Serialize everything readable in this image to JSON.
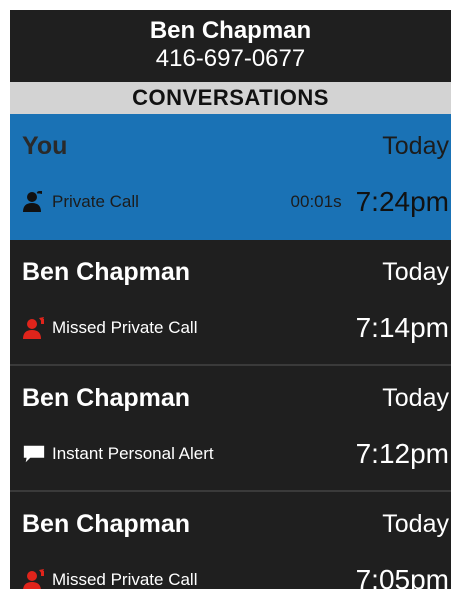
{
  "header": {
    "contact_name": "Ben Chapman",
    "phone_number": "416-697-0677"
  },
  "section_title": "CONVERSATIONS",
  "conversations": [
    {
      "sender": "You",
      "day": "Today",
      "icon": "outgoing-private-call-icon",
      "label": "Private Call",
      "duration": "00:01s",
      "time": "7:24pm",
      "selected": true
    },
    {
      "sender": "Ben Chapman",
      "day": "Today",
      "icon": "missed-private-call-icon",
      "label": "Missed Private Call",
      "duration": "",
      "time": "7:14pm",
      "selected": false
    },
    {
      "sender": "Ben Chapman",
      "day": "Today",
      "icon": "alert-message-icon",
      "label": "Instant Personal Alert",
      "duration": "",
      "time": "7:12pm",
      "selected": false
    },
    {
      "sender": "Ben Chapman",
      "day": "Today",
      "icon": "missed-private-call-icon",
      "label": "Missed Private Call",
      "duration": "",
      "time": "7:05pm",
      "selected": false
    }
  ],
  "colors": {
    "background": "#1f1f1f",
    "selected": "#1a72b5",
    "section_bar": "#d3d3d3",
    "missed_accent": "#e0241b"
  }
}
